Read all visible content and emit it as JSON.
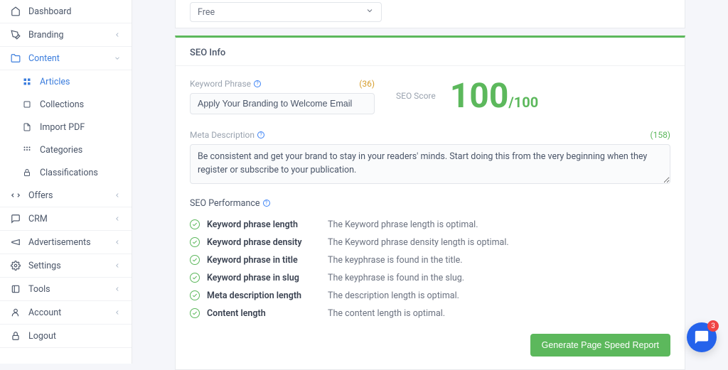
{
  "sidebar": {
    "items": [
      {
        "label": "Dashboard",
        "chevron": false,
        "active": false
      },
      {
        "label": "Branding",
        "chevron": true,
        "active": false
      },
      {
        "label": "Content",
        "chevron": true,
        "active": true,
        "open": true,
        "children": [
          {
            "label": "Articles",
            "active": true
          },
          {
            "label": "Collections",
            "active": false
          },
          {
            "label": "Import PDF",
            "active": false
          },
          {
            "label": "Categories",
            "active": false
          },
          {
            "label": "Classifications",
            "active": false
          }
        ]
      },
      {
        "label": "Offers",
        "chevron": true,
        "active": false
      },
      {
        "label": "CRM",
        "chevron": true,
        "active": false
      },
      {
        "label": "Advertisements",
        "chevron": true,
        "active": false
      },
      {
        "label": "Settings",
        "chevron": true,
        "active": false
      },
      {
        "label": "Tools",
        "chevron": true,
        "active": false
      },
      {
        "label": "Account",
        "chevron": true,
        "active": false
      },
      {
        "label": "Logout",
        "chevron": false,
        "active": false
      }
    ]
  },
  "top_select": {
    "value": "Free"
  },
  "card": {
    "title": "SEO Info",
    "keyword_phrase": {
      "label": "Keyword Phrase",
      "count": "(36)",
      "value": "Apply Your Branding to Welcome Email"
    },
    "seo_score": {
      "label": "SEO Score",
      "value": "100",
      "denom": "/100"
    },
    "meta_description": {
      "label": "Meta Description",
      "count": "(158)",
      "value": "Be consistent and get your brand to stay in your readers' minds. Start doing this from the very beginning when they register or subscribe to your publication."
    },
    "performance": {
      "title": "SEO Performance",
      "items": [
        {
          "name": "Keyword phrase length",
          "desc": "The Keyword phrase length is optimal."
        },
        {
          "name": "Keyword phrase density",
          "desc": "The Keyword phrase density length is optimal."
        },
        {
          "name": "Keyword phrase in title",
          "desc": "The keyphrase is found in the title."
        },
        {
          "name": "Keyword phrase in slug",
          "desc": "The keyphrase is found in the slug."
        },
        {
          "name": "Meta description length",
          "desc": "The description length is optimal."
        },
        {
          "name": "Content length",
          "desc": "The content length is optimal."
        }
      ]
    },
    "generate_button": "Generate Page Speed Report"
  },
  "chat": {
    "badge": "3"
  }
}
